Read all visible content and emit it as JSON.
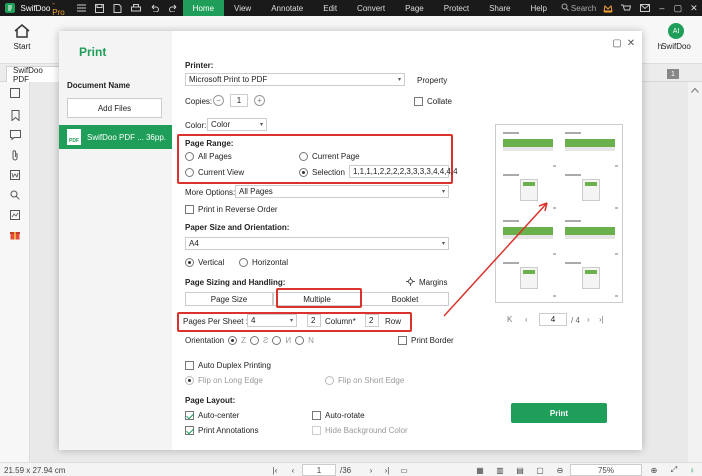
{
  "titlebar": {
    "app_name": "SwifDoo",
    "app_edition": "-Pro",
    "search_placeholder": "Search",
    "menu": [
      "Home",
      "View",
      "Annotate",
      "Edit",
      "Convert",
      "Page",
      "Protect",
      "Share",
      "Help"
    ],
    "active_menu": "Home"
  },
  "ribbon": {
    "start_label": "Start",
    "right_label_1": "h",
    "right_label_2": "SwifDoo",
    "avatar_initials": "AI"
  },
  "tabs": {
    "doc_tab": "SwifDoo PDF",
    "page_badge": "1"
  },
  "dialog": {
    "title": "Print",
    "document_name_label": "Document Name",
    "add_files_label": "Add Files",
    "doc_item": {
      "name": "SwifDoo PDF ...",
      "pages": "36pp.",
      "icon_text": "PDF"
    },
    "printer_label": "Printer:",
    "printer_value": "Microsoft Print to PDF",
    "property_label": "Property",
    "copies_label": "Copies:",
    "copies_value": "1",
    "collate_label": "Collate",
    "color_label": "Color:",
    "color_value": "Color",
    "page_range": {
      "title": "Page Range:",
      "all_pages": "All Pages",
      "current_page": "Current Page",
      "current_view": "Current View",
      "selection": "Selection",
      "selection_value": "1,1,1,1,2,2,2,2,3,3,3,3,4,4,4,4"
    },
    "more_options_label": "More Options:",
    "more_options_value": "All Pages",
    "reverse_order_label": "Print in Reverse Order",
    "paper_size_title": "Paper Size and Orientation:",
    "paper_size_value": "A4",
    "vertical_label": "Vertical",
    "horizontal_label": "Horizontal",
    "sizing_title": "Page Sizing and Handling:",
    "margins_label": "Margins",
    "sizing_tabs": [
      "Page Size",
      "Multiple",
      "Booklet"
    ],
    "pages_per_sheet_label": "Pages Per Sheet :",
    "pages_per_sheet_value": "4",
    "columns_value": "2",
    "column_label": "Column*",
    "rows_value": "2",
    "row_label": "Row",
    "orientation_label": "Orientation",
    "print_border_label": "Print Border",
    "duplex_label": "Auto Duplex Printing",
    "flip_long_label": "Flip on Long Edge",
    "flip_short_label": "Flip on Short Edge",
    "layout_title": "Page Layout:",
    "auto_center_label": "Auto-center",
    "auto_rotate_label": "Auto-rotate",
    "print_annotations_label": "Print Annotations",
    "hide_bg_label": "Hide Background Color",
    "print_button": "Print",
    "preview_nav": {
      "current": "4",
      "total": "/ 4"
    }
  },
  "statusbar": {
    "page_size": "21.59 x 27.94 cm",
    "current_page": "1",
    "total_pages": "/36",
    "zoom": "75%"
  },
  "colors": {
    "accent": "#1e9e58",
    "highlight": "#d9332b",
    "dark": "#1a1a1a"
  }
}
